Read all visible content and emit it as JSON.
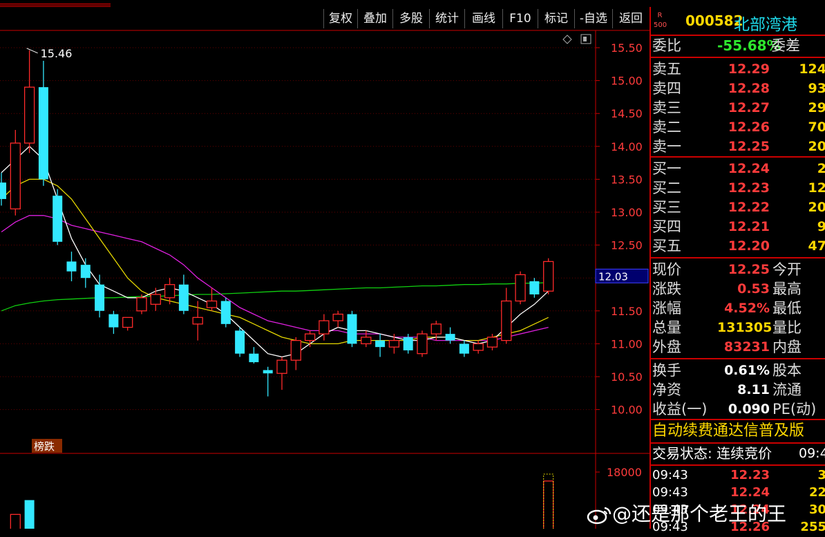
{
  "toolbar": {
    "buttons": [
      "复权",
      "叠加",
      "多股",
      "统计",
      "画线",
      "F10",
      "标记",
      "-自选",
      "返回"
    ]
  },
  "stock": {
    "badge_top": "R",
    "badge_bottom": "500",
    "code": "000582",
    "name": "北部湾港"
  },
  "weibi": {
    "label": "委比",
    "value": "-55.68%",
    "label2": "委差"
  },
  "asks": [
    {
      "label": "卖五",
      "price": "12.29",
      "vol": "124"
    },
    {
      "label": "卖四",
      "price": "12.28",
      "vol": "93"
    },
    {
      "label": "卖三",
      "price": "12.27",
      "vol": "29"
    },
    {
      "label": "卖二",
      "price": "12.26",
      "vol": "70"
    },
    {
      "label": "卖一",
      "price": "12.25",
      "vol": "20"
    }
  ],
  "bids": [
    {
      "label": "买一",
      "price": "12.24",
      "vol": "2"
    },
    {
      "label": "买二",
      "price": "12.23",
      "vol": "12"
    },
    {
      "label": "买三",
      "price": "12.22",
      "vol": "20"
    },
    {
      "label": "买四",
      "price": "12.21",
      "vol": "9"
    },
    {
      "label": "买五",
      "price": "12.20",
      "vol": "47"
    }
  ],
  "quote": [
    {
      "label": "现价",
      "value": "12.25",
      "label2": "今开"
    },
    {
      "label": "涨跌",
      "value": "0.53",
      "label2": "最高"
    },
    {
      "label": "涨幅",
      "value": "4.52%",
      "label2": "最低"
    },
    {
      "label": "总量",
      "value": "131305",
      "label2": "量比"
    },
    {
      "label": "外盘",
      "value": "83231",
      "label2": "内盘"
    }
  ],
  "fund": [
    {
      "label": "换手",
      "value": "0.61%",
      "label2": "股本"
    },
    {
      "label": "净资",
      "value": "8.11",
      "label2": "流通"
    },
    {
      "label": "收益(一)",
      "value": "0.090",
      "label2": "PE(动)"
    }
  ],
  "banner": "自动续费通达信普及版",
  "status": {
    "label": "交易状态: 连续竞价",
    "time": "09:4"
  },
  "ticks": [
    {
      "time": "09:43",
      "price": "12.23",
      "vol": "3"
    },
    {
      "time": "09:43",
      "price": "12.24",
      "vol": "22"
    },
    {
      "time": "09:43",
      "price": "12.24",
      "vol": "30"
    },
    {
      "time": "09:43",
      "price": "12.26",
      "vol": "255"
    }
  ],
  "watermark": "@还是那个老王的王",
  "chart_data": {
    "type": "candlestick",
    "price_axis": {
      "ticks": [
        15.5,
        15.0,
        14.5,
        14.0,
        13.5,
        13.0,
        12.5,
        12.0,
        11.5,
        11.0,
        10.5,
        10.0
      ],
      "tick_labels": [
        "15.50",
        "15.00",
        "14.50",
        "14.00",
        "13.50",
        "13.00",
        "12.50",
        "12.00",
        "11.50",
        "11.00",
        "10.50",
        "10.00"
      ],
      "ylim": [
        9.5,
        16.0
      ]
    },
    "current_price_label": "12.03",
    "high_annotation": "15.46",
    "bang_die_label": "榜跌",
    "volume_axis": {
      "ticks": [
        18000
      ],
      "tick_labels": [
        "18000"
      ]
    },
    "colors": {
      "up": "#ff2a2a",
      "down": "#33e8ff",
      "ma5": "#ffffff",
      "ma10": "#e6d800",
      "ma20": "#e020e0",
      "ma60": "#10d010"
    },
    "candles": [
      {
        "o": 13.45,
        "h": 13.6,
        "l": 13.1,
        "c": 13.2
      },
      {
        "o": 13.05,
        "h": 14.25,
        "l": 12.95,
        "c": 14.05
      },
      {
        "o": 14.05,
        "h": 15.46,
        "l": 13.9,
        "c": 14.9
      },
      {
        "o": 14.9,
        "h": 15.3,
        "l": 13.4,
        "c": 13.5
      },
      {
        "o": 13.25,
        "h": 13.35,
        "l": 12.5,
        "c": 12.55
      },
      {
        "o": 12.25,
        "h": 12.4,
        "l": 11.95,
        "c": 12.1
      },
      {
        "o": 12.2,
        "h": 12.3,
        "l": 11.85,
        "c": 12.0
      },
      {
        "o": 11.9,
        "h": 12.05,
        "l": 11.4,
        "c": 11.5
      },
      {
        "o": 11.45,
        "h": 11.5,
        "l": 11.15,
        "c": 11.25
      },
      {
        "o": 11.25,
        "h": 11.4,
        "l": 11.2,
        "c": 11.4
      },
      {
        "o": 11.5,
        "h": 11.75,
        "l": 11.45,
        "c": 11.7
      },
      {
        "o": 11.6,
        "h": 11.85,
        "l": 11.5,
        "c": 11.75
      },
      {
        "o": 11.7,
        "h": 12.0,
        "l": 11.6,
        "c": 11.9
      },
      {
        "o": 11.9,
        "h": 12.05,
        "l": 11.45,
        "c": 11.5
      },
      {
        "o": 11.3,
        "h": 11.65,
        "l": 11.05,
        "c": 11.4
      },
      {
        "o": 11.55,
        "h": 11.85,
        "l": 11.5,
        "c": 11.65
      },
      {
        "o": 11.65,
        "h": 11.7,
        "l": 11.25,
        "c": 11.3
      },
      {
        "o": 11.2,
        "h": 11.25,
        "l": 10.8,
        "c": 10.85
      },
      {
        "o": 10.85,
        "h": 10.95,
        "l": 10.7,
        "c": 10.72
      },
      {
        "o": 10.6,
        "h": 10.65,
        "l": 10.2,
        "c": 10.55
      },
      {
        "o": 10.55,
        "h": 10.8,
        "l": 10.3,
        "c": 10.75
      },
      {
        "o": 10.75,
        "h": 11.1,
        "l": 10.6,
        "c": 11.05
      },
      {
        "o": 11.05,
        "h": 11.2,
        "l": 10.95,
        "c": 11.15
      },
      {
        "o": 11.15,
        "h": 11.45,
        "l": 11.05,
        "c": 11.35
      },
      {
        "o": 11.35,
        "h": 11.5,
        "l": 11.25,
        "c": 11.45
      },
      {
        "o": 11.45,
        "h": 11.5,
        "l": 10.95,
        "c": 11.0
      },
      {
        "o": 11.0,
        "h": 11.2,
        "l": 10.95,
        "c": 11.1
      },
      {
        "o": 11.05,
        "h": 11.15,
        "l": 10.8,
        "c": 10.95
      },
      {
        "o": 10.95,
        "h": 11.15,
        "l": 10.85,
        "c": 11.05
      },
      {
        "o": 11.1,
        "h": 11.15,
        "l": 10.85,
        "c": 10.9
      },
      {
        "o": 10.85,
        "h": 11.2,
        "l": 10.8,
        "c": 11.15
      },
      {
        "o": 11.15,
        "h": 11.35,
        "l": 11.05,
        "c": 11.3
      },
      {
        "o": 11.15,
        "h": 11.25,
        "l": 11.0,
        "c": 11.05
      },
      {
        "o": 11.0,
        "h": 11.05,
        "l": 10.8,
        "c": 10.85
      },
      {
        "o": 10.9,
        "h": 11.05,
        "l": 10.85,
        "c": 11.0
      },
      {
        "o": 10.95,
        "h": 11.15,
        "l": 10.9,
        "c": 11.1
      },
      {
        "o": 11.05,
        "h": 11.85,
        "l": 11.0,
        "c": 11.65
      },
      {
        "o": 11.65,
        "h": 12.1,
        "l": 11.6,
        "c": 12.05
      },
      {
        "o": 11.95,
        "h": 12.0,
        "l": 11.7,
        "c": 11.75
      },
      {
        "o": 11.8,
        "h": 12.3,
        "l": 11.75,
        "c": 12.25
      }
    ],
    "ma5": [
      13.6,
      13.8,
      14.0,
      13.8,
      13.2,
      12.6,
      12.2,
      11.9,
      11.8,
      11.7,
      11.7,
      11.8,
      11.85,
      11.8,
      11.7,
      11.6,
      11.45,
      11.25,
      11.05,
      10.85,
      10.8,
      10.85,
      11.0,
      11.15,
      11.25,
      11.2,
      11.2,
      11.15,
      11.1,
      11.05,
      11.05,
      11.1,
      11.1,
      11.05,
      11.0,
      11.05,
      11.25,
      11.45,
      11.6,
      11.8
    ],
    "ma10": [
      13.2,
      13.4,
      13.5,
      13.5,
      13.4,
      13.2,
      12.9,
      12.6,
      12.3,
      12.0,
      11.8,
      11.7,
      11.65,
      11.6,
      11.55,
      11.5,
      11.45,
      11.4,
      11.3,
      11.2,
      11.1,
      11.05,
      11.0,
      11.0,
      11.0,
      11.05,
      11.05,
      11.05,
      11.05,
      11.05,
      11.1,
      11.1,
      11.1,
      11.05,
      11.05,
      11.1,
      11.15,
      11.2,
      11.3,
      11.4
    ],
    "ma20": [
      12.7,
      12.85,
      12.95,
      12.95,
      12.9,
      12.8,
      12.75,
      12.7,
      12.65,
      12.6,
      12.55,
      12.45,
      12.35,
      12.2,
      12.0,
      11.85,
      11.7,
      11.55,
      11.45,
      11.35,
      11.3,
      11.25,
      11.2,
      11.2,
      11.2,
      11.15,
      11.15,
      11.15,
      11.1,
      11.1,
      11.1,
      11.05,
      11.05,
      11.05,
      11.05,
      11.05,
      11.1,
      11.15,
      11.2,
      11.25
    ],
    "ma60": [
      11.5,
      11.58,
      11.62,
      11.65,
      11.67,
      11.68,
      11.69,
      11.7,
      11.7,
      11.71,
      11.72,
      11.72,
      11.73,
      11.74,
      11.75,
      11.75,
      11.76,
      11.77,
      11.78,
      11.79,
      11.8,
      11.8,
      11.81,
      11.82,
      11.83,
      11.84,
      11.85,
      11.85,
      11.86,
      11.87,
      11.88,
      11.88,
      11.89,
      11.9,
      11.9,
      11.91,
      11.91,
      11.92,
      11.92,
      11.93
    ],
    "volume_visible": [
      {
        "index": 1,
        "value": 4500,
        "dir": "up"
      },
      {
        "index": 2,
        "value": 9000,
        "dir": "down"
      },
      {
        "index": 39,
        "value": 15000,
        "dir": "up"
      }
    ]
  }
}
